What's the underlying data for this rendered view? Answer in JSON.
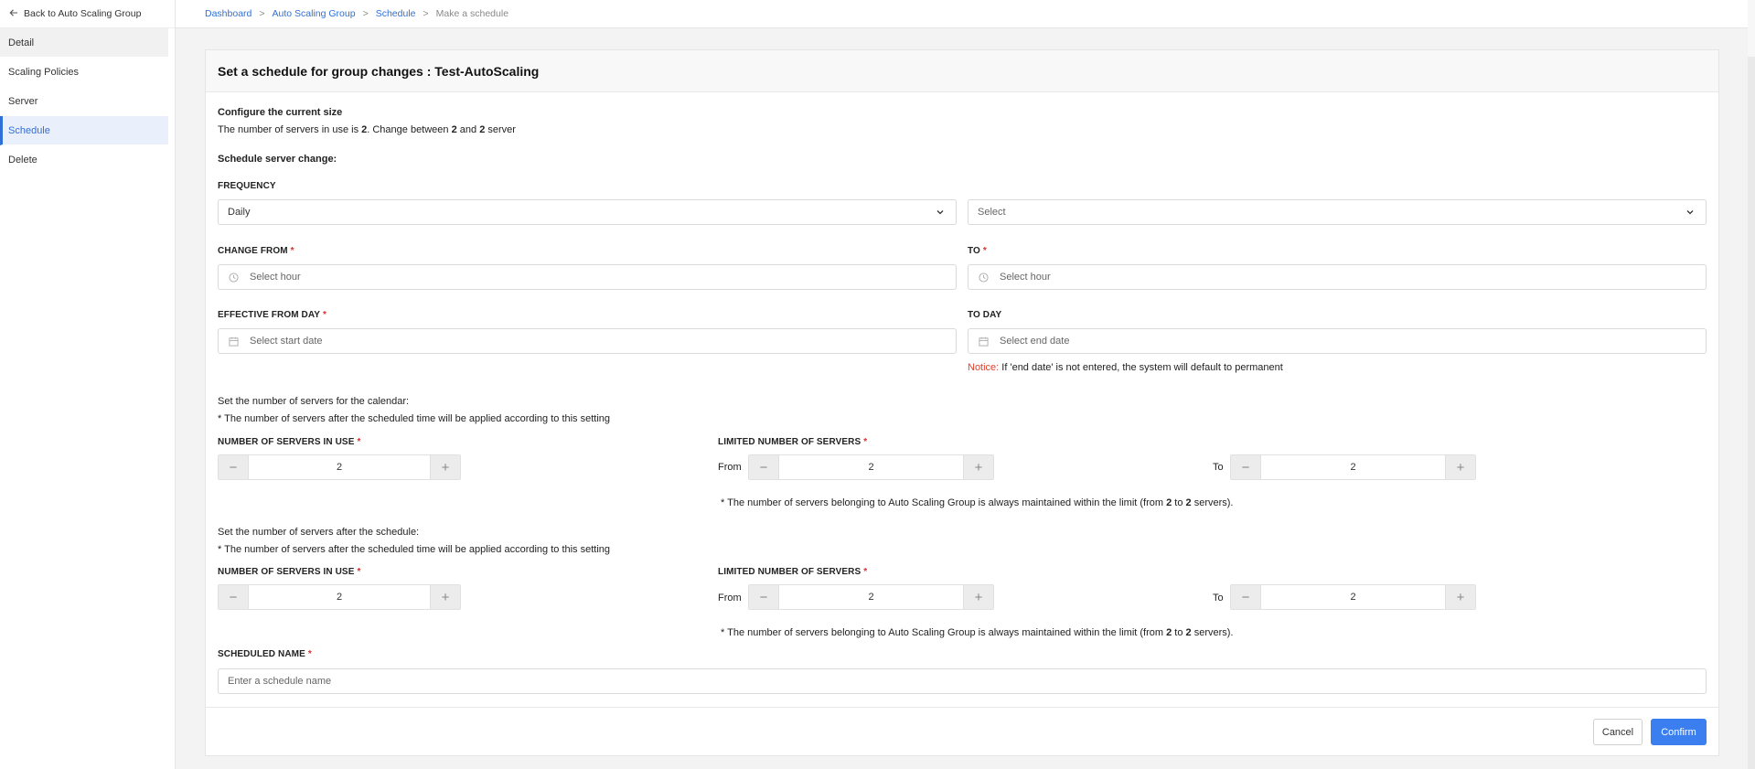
{
  "sidebar": {
    "back_label": "Back to Auto Scaling Group",
    "items": [
      {
        "label": "Detail"
      },
      {
        "label": "Scaling Policies"
      },
      {
        "label": "Server"
      },
      {
        "label": "Schedule"
      },
      {
        "label": "Delete"
      }
    ]
  },
  "breadcrumb": {
    "items": [
      "Dashboard",
      "Auto Scaling Group",
      "Schedule"
    ],
    "current": "Make a schedule",
    "separator": ">"
  },
  "page": {
    "title": "Set a schedule for group changes : Test-AutoScaling"
  },
  "current_size": {
    "heading": "Configure the current size",
    "text_prefix": "The number of servers in use is ",
    "in_use": "2",
    "text_mid": ". Change between ",
    "min": "2",
    "text_and": " and ",
    "max": "2",
    "text_suffix": " server"
  },
  "schedule": {
    "heading": "Schedule server change:",
    "frequency_label": "FREQUENCY",
    "frequency_value": "Daily",
    "frequency_second_placeholder": "Select",
    "change_from_label": "CHANGE FROM",
    "change_from_placeholder": "Select hour",
    "to_label": "TO",
    "to_placeholder": "Select hour",
    "effective_from_label": "EFFECTIVE FROM DAY",
    "effective_from_placeholder": "Select start date",
    "to_day_label": "TO DAY",
    "to_day_placeholder": "Select end date",
    "notice_label": "Notice:",
    "notice_text": " If 'end date' is not entered, the system will default to permanent"
  },
  "calendar_servers": {
    "heading": "Set the number of servers for the calendar:",
    "subtext": "* The number of servers after the scheduled time will be applied according to this setting",
    "in_use_label": "NUMBER OF SERVERS IN USE",
    "in_use_value": "2",
    "limited_label": "LIMITED NUMBER OF SERVERS",
    "from_label": "From",
    "from_value": "2",
    "to_label": "To",
    "to_value": "2",
    "note_prefix": "* The number of servers belonging to Auto Scaling Group is always maintained within the limit (from ",
    "note_from": "2",
    "note_mid": " to ",
    "note_to": "2",
    "note_suffix": " servers)."
  },
  "after_servers": {
    "heading": "Set the number of servers after the schedule:",
    "subtext": "* The number of servers after the scheduled time will be applied according to this setting",
    "in_use_label": "NUMBER OF SERVERS IN USE",
    "in_use_value": "2",
    "limited_label": "LIMITED NUMBER OF SERVERS",
    "from_label": "From",
    "from_value": "2",
    "to_label": "To",
    "to_value": "2",
    "note_prefix": "* The number of servers belonging to Auto Scaling Group is always maintained within the limit (from ",
    "note_from": "2",
    "note_mid": " to ",
    "note_to": "2",
    "note_suffix": " servers)."
  },
  "scheduled_name": {
    "label": "SCHEDULED NAME",
    "placeholder": "Enter a schedule name"
  },
  "required_mark": "*",
  "stepper": {
    "minus": "−",
    "plus": "+"
  },
  "footer": {
    "cancel_label": "Cancel",
    "confirm_label": "Confirm"
  },
  "colors": {
    "accent": "#3a7ef0",
    "required": "#e02d2d",
    "notice": "#e0432d"
  },
  "icons": {
    "back": "arrow-left-icon",
    "chevron": "chevron-down-icon",
    "clock": "clock-icon",
    "calendar": "calendar-icon",
    "minus": "minus-icon",
    "plus": "plus-icon"
  }
}
